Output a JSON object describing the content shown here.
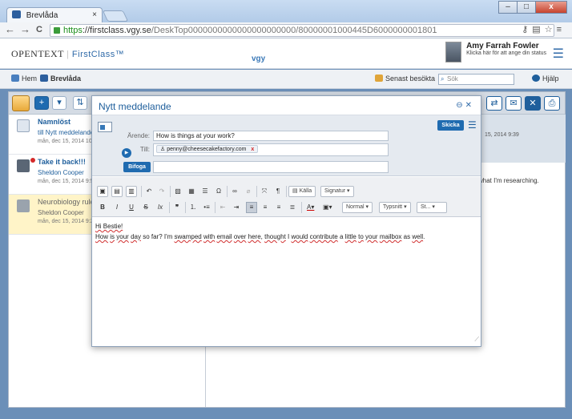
{
  "browser": {
    "tab_title": "Brevlåda",
    "tab_close": "×",
    "url_https": "https",
    "url_host": "://firstclass.vgy.se",
    "url_path": "/DeskTop0000000000000000000000/80000001000445D6000000001801",
    "nav_back": "←",
    "nav_forward": "→",
    "nav_reload": "C",
    "win_min": "–",
    "win_max": "□",
    "win_close": "x"
  },
  "header": {
    "logo_text": "OpenText",
    "logo_product": "FirstClass™",
    "site_name": "vgy",
    "user_name": "Amy Farrah Fowler",
    "user_status": "Klicka här för att ange din status"
  },
  "crumbs": {
    "home": "Hem",
    "mailbox": "Brevlåda",
    "recent": "Senast besökta",
    "search_placeholder": "Sök",
    "help": "Hjälp"
  },
  "messages": [
    {
      "subject": "Namnlöst",
      "from": "till Nytt meddelande",
      "date": "mån, dec 15, 2014 10..."
    },
    {
      "subject": "Take it back!!!",
      "from": "Sheldon Cooper",
      "date": "mån, dec 15, 2014 9:5..."
    },
    {
      "subject": "Neurobiology rules",
      "from": "Sheldon Cooper",
      "date": "mån, dec 15, 2014 9:2..."
    }
  ],
  "preview": {
    "date_fragment": "15, 2014 9:39",
    "text_fragment": "what I'm researching."
  },
  "compose": {
    "title": "Nytt meddelande",
    "subject_label": "Ärende:",
    "subject_value": "How is things at your work?",
    "to_label": "Till:",
    "to_value": "penny@cheesecakefactory.com",
    "attach_label": "Bifoga",
    "send_label": "Skicka",
    "toolbar": {
      "source_label": "Källa",
      "signature_label": "Signatur",
      "format_label": "Normal",
      "font_label": "Typsnitt",
      "size_label": "St..."
    },
    "body": {
      "greeting": "Hi Bestie!",
      "line2_parts": [
        "How",
        " ",
        "is",
        " ",
        "your",
        " ",
        "day",
        " so far? I'm ",
        "swamped",
        " ",
        "with",
        " ",
        "email",
        " ",
        "over",
        " ",
        "here",
        ", ",
        "thought",
        " I ",
        "would",
        " ",
        "contribute",
        " a ",
        "little",
        " ",
        "to",
        " ",
        "your",
        " ",
        "mailbox",
        " as ",
        "well",
        "."
      ]
    }
  }
}
